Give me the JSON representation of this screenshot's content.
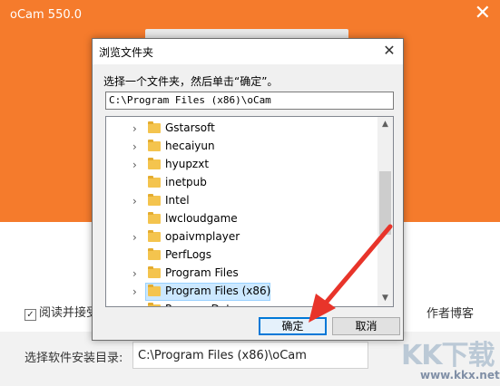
{
  "installer": {
    "title": "oCam 550.0",
    "close_glyph": "✕",
    "agree_label": "阅读并接受",
    "agree_checked_glyph": "✓",
    "author_link": "作者博客",
    "install_dir_label": "选择软件安装目录:",
    "install_dir_value": "C:\\Program Files (x86)\\oCam"
  },
  "dialog": {
    "title": "浏览文件夹",
    "close_glyph": "✕",
    "prompt": "选择一个文件夹，然后单击“确定”。",
    "path_value": "C:\\Program Files (x86)\\oCam",
    "folders": [
      {
        "label": "Gstarsoft",
        "expandable": true
      },
      {
        "label": "hecaiyun",
        "expandable": true
      },
      {
        "label": "hyupzxt",
        "expandable": true
      },
      {
        "label": "inetpub",
        "expandable": false
      },
      {
        "label": "Intel",
        "expandable": true
      },
      {
        "label": "lwcloudgame",
        "expandable": false
      },
      {
        "label": "opaivmplayer",
        "expandable": true
      },
      {
        "label": "PerfLogs",
        "expandable": false
      },
      {
        "label": "Program Files",
        "expandable": true
      },
      {
        "label": "Program Files (x86)",
        "expandable": true,
        "selected": true
      },
      {
        "label": "ProgramData",
        "expandable": true
      }
    ],
    "ok_label": "确定",
    "cancel_label": "取消"
  },
  "watermark": {
    "logo_text": "KK下载",
    "url": "www.kkx.net"
  },
  "colors": {
    "brand_orange": "#f57b2c",
    "selection_bg": "#cce8ff",
    "ok_border": "#0078d7",
    "arrow_red": "#e8342a"
  },
  "icons": [
    "folder-icon",
    "chevron-right-icon",
    "close-icon",
    "check-icon",
    "scroll-up-icon",
    "scroll-down-icon"
  ]
}
